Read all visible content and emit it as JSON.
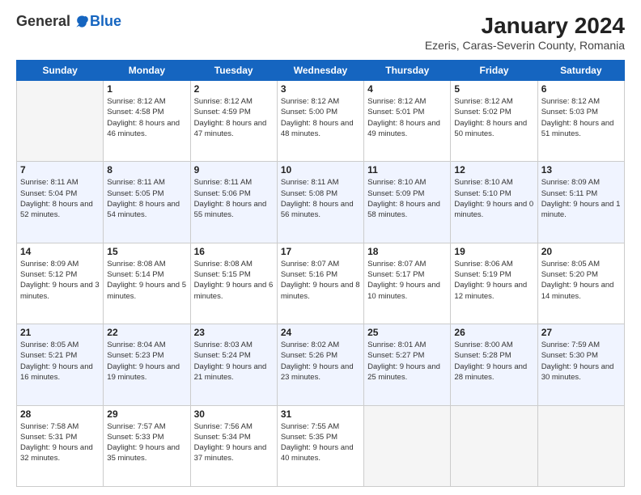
{
  "header": {
    "logo_general": "General",
    "logo_blue": "Blue",
    "main_title": "January 2024",
    "subtitle": "Ezeris, Caras-Severin County, Romania"
  },
  "days_of_week": [
    "Sunday",
    "Monday",
    "Tuesday",
    "Wednesday",
    "Thursday",
    "Friday",
    "Saturday"
  ],
  "weeks": [
    [
      {
        "num": "",
        "sunrise": "",
        "sunset": "",
        "daylight": ""
      },
      {
        "num": "1",
        "sunrise": "Sunrise: 8:12 AM",
        "sunset": "Sunset: 4:58 PM",
        "daylight": "Daylight: 8 hours and 46 minutes."
      },
      {
        "num": "2",
        "sunrise": "Sunrise: 8:12 AM",
        "sunset": "Sunset: 4:59 PM",
        "daylight": "Daylight: 8 hours and 47 minutes."
      },
      {
        "num": "3",
        "sunrise": "Sunrise: 8:12 AM",
        "sunset": "Sunset: 5:00 PM",
        "daylight": "Daylight: 8 hours and 48 minutes."
      },
      {
        "num": "4",
        "sunrise": "Sunrise: 8:12 AM",
        "sunset": "Sunset: 5:01 PM",
        "daylight": "Daylight: 8 hours and 49 minutes."
      },
      {
        "num": "5",
        "sunrise": "Sunrise: 8:12 AM",
        "sunset": "Sunset: 5:02 PM",
        "daylight": "Daylight: 8 hours and 50 minutes."
      },
      {
        "num": "6",
        "sunrise": "Sunrise: 8:12 AM",
        "sunset": "Sunset: 5:03 PM",
        "daylight": "Daylight: 8 hours and 51 minutes."
      }
    ],
    [
      {
        "num": "7",
        "sunrise": "Sunrise: 8:11 AM",
        "sunset": "Sunset: 5:04 PM",
        "daylight": "Daylight: 8 hours and 52 minutes."
      },
      {
        "num": "8",
        "sunrise": "Sunrise: 8:11 AM",
        "sunset": "Sunset: 5:05 PM",
        "daylight": "Daylight: 8 hours and 54 minutes."
      },
      {
        "num": "9",
        "sunrise": "Sunrise: 8:11 AM",
        "sunset": "Sunset: 5:06 PM",
        "daylight": "Daylight: 8 hours and 55 minutes."
      },
      {
        "num": "10",
        "sunrise": "Sunrise: 8:11 AM",
        "sunset": "Sunset: 5:08 PM",
        "daylight": "Daylight: 8 hours and 56 minutes."
      },
      {
        "num": "11",
        "sunrise": "Sunrise: 8:10 AM",
        "sunset": "Sunset: 5:09 PM",
        "daylight": "Daylight: 8 hours and 58 minutes."
      },
      {
        "num": "12",
        "sunrise": "Sunrise: 8:10 AM",
        "sunset": "Sunset: 5:10 PM",
        "daylight": "Daylight: 9 hours and 0 minutes."
      },
      {
        "num": "13",
        "sunrise": "Sunrise: 8:09 AM",
        "sunset": "Sunset: 5:11 PM",
        "daylight": "Daylight: 9 hours and 1 minute."
      }
    ],
    [
      {
        "num": "14",
        "sunrise": "Sunrise: 8:09 AM",
        "sunset": "Sunset: 5:12 PM",
        "daylight": "Daylight: 9 hours and 3 minutes."
      },
      {
        "num": "15",
        "sunrise": "Sunrise: 8:08 AM",
        "sunset": "Sunset: 5:14 PM",
        "daylight": "Daylight: 9 hours and 5 minutes."
      },
      {
        "num": "16",
        "sunrise": "Sunrise: 8:08 AM",
        "sunset": "Sunset: 5:15 PM",
        "daylight": "Daylight: 9 hours and 6 minutes."
      },
      {
        "num": "17",
        "sunrise": "Sunrise: 8:07 AM",
        "sunset": "Sunset: 5:16 PM",
        "daylight": "Daylight: 9 hours and 8 minutes."
      },
      {
        "num": "18",
        "sunrise": "Sunrise: 8:07 AM",
        "sunset": "Sunset: 5:17 PM",
        "daylight": "Daylight: 9 hours and 10 minutes."
      },
      {
        "num": "19",
        "sunrise": "Sunrise: 8:06 AM",
        "sunset": "Sunset: 5:19 PM",
        "daylight": "Daylight: 9 hours and 12 minutes."
      },
      {
        "num": "20",
        "sunrise": "Sunrise: 8:05 AM",
        "sunset": "Sunset: 5:20 PM",
        "daylight": "Daylight: 9 hours and 14 minutes."
      }
    ],
    [
      {
        "num": "21",
        "sunrise": "Sunrise: 8:05 AM",
        "sunset": "Sunset: 5:21 PM",
        "daylight": "Daylight: 9 hours and 16 minutes."
      },
      {
        "num": "22",
        "sunrise": "Sunrise: 8:04 AM",
        "sunset": "Sunset: 5:23 PM",
        "daylight": "Daylight: 9 hours and 19 minutes."
      },
      {
        "num": "23",
        "sunrise": "Sunrise: 8:03 AM",
        "sunset": "Sunset: 5:24 PM",
        "daylight": "Daylight: 9 hours and 21 minutes."
      },
      {
        "num": "24",
        "sunrise": "Sunrise: 8:02 AM",
        "sunset": "Sunset: 5:26 PM",
        "daylight": "Daylight: 9 hours and 23 minutes."
      },
      {
        "num": "25",
        "sunrise": "Sunrise: 8:01 AM",
        "sunset": "Sunset: 5:27 PM",
        "daylight": "Daylight: 9 hours and 25 minutes."
      },
      {
        "num": "26",
        "sunrise": "Sunrise: 8:00 AM",
        "sunset": "Sunset: 5:28 PM",
        "daylight": "Daylight: 9 hours and 28 minutes."
      },
      {
        "num": "27",
        "sunrise": "Sunrise: 7:59 AM",
        "sunset": "Sunset: 5:30 PM",
        "daylight": "Daylight: 9 hours and 30 minutes."
      }
    ],
    [
      {
        "num": "28",
        "sunrise": "Sunrise: 7:58 AM",
        "sunset": "Sunset: 5:31 PM",
        "daylight": "Daylight: 9 hours and 32 minutes."
      },
      {
        "num": "29",
        "sunrise": "Sunrise: 7:57 AM",
        "sunset": "Sunset: 5:33 PM",
        "daylight": "Daylight: 9 hours and 35 minutes."
      },
      {
        "num": "30",
        "sunrise": "Sunrise: 7:56 AM",
        "sunset": "Sunset: 5:34 PM",
        "daylight": "Daylight: 9 hours and 37 minutes."
      },
      {
        "num": "31",
        "sunrise": "Sunrise: 7:55 AM",
        "sunset": "Sunset: 5:35 PM",
        "daylight": "Daylight: 9 hours and 40 minutes."
      },
      {
        "num": "",
        "sunrise": "",
        "sunset": "",
        "daylight": ""
      },
      {
        "num": "",
        "sunrise": "",
        "sunset": "",
        "daylight": ""
      },
      {
        "num": "",
        "sunrise": "",
        "sunset": "",
        "daylight": ""
      }
    ]
  ]
}
